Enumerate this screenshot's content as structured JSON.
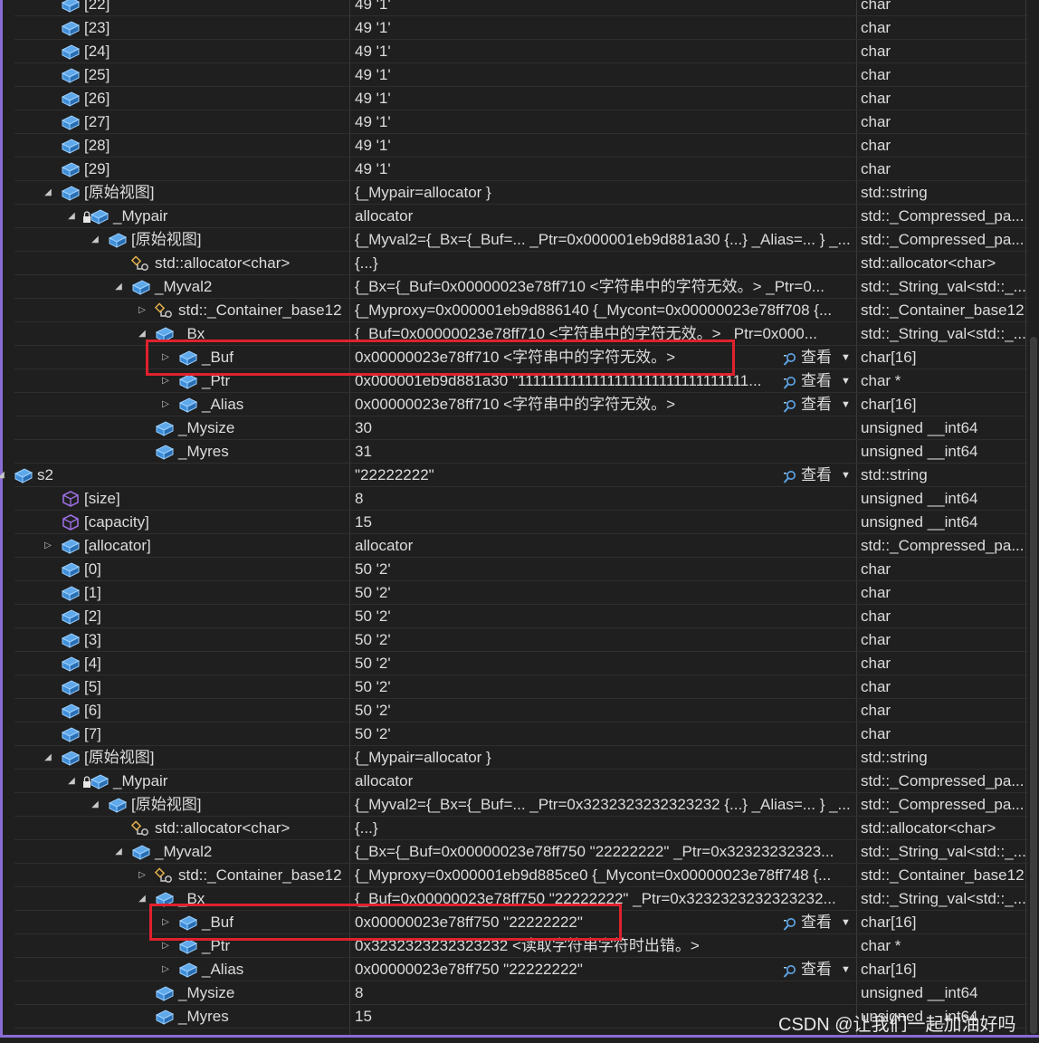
{
  "view_label": "查看",
  "watermark": "CSDN @让我们一起加油好吗",
  "colors": {
    "accent": "#8a6bd6",
    "highlight": "#e0212e",
    "icon_fill": "#3f8ed9",
    "prop_icon": "#9b6ee0"
  },
  "rows": [
    {
      "indent": 3,
      "exp": "none",
      "icon": "variable-icon",
      "name": "[22]",
      "value": "49 '1'",
      "type": "char"
    },
    {
      "indent": 3,
      "exp": "none",
      "icon": "variable-icon",
      "name": "[23]",
      "value": "49 '1'",
      "type": "char"
    },
    {
      "indent": 3,
      "exp": "none",
      "icon": "variable-icon",
      "name": "[24]",
      "value": "49 '1'",
      "type": "char"
    },
    {
      "indent": 3,
      "exp": "none",
      "icon": "variable-icon",
      "name": "[25]",
      "value": "49 '1'",
      "type": "char"
    },
    {
      "indent": 3,
      "exp": "none",
      "icon": "variable-icon",
      "name": "[26]",
      "value": "49 '1'",
      "type": "char"
    },
    {
      "indent": 3,
      "exp": "none",
      "icon": "variable-icon",
      "name": "[27]",
      "value": "49 '1'",
      "type": "char"
    },
    {
      "indent": 3,
      "exp": "none",
      "icon": "variable-icon",
      "name": "[28]",
      "value": "49 '1'",
      "type": "char"
    },
    {
      "indent": 3,
      "exp": "none",
      "icon": "variable-icon",
      "name": "[29]",
      "value": "49 '1'",
      "type": "char"
    },
    {
      "indent": 3,
      "exp": "expanded",
      "icon": "variable-icon",
      "name": "[原始视图]",
      "value": "{_Mypair=allocator }",
      "type": "std::string"
    },
    {
      "indent": 4,
      "exp": "expanded",
      "icon": "variable-icon",
      "lock": true,
      "name": "_Mypair",
      "value": "allocator",
      "type": "std::_Compressed_pa..."
    },
    {
      "indent": 5,
      "exp": "expanded",
      "icon": "variable-icon",
      "name": "[原始视图]",
      "value": "{_Myval2={_Bx={_Buf=... _Ptr=0x000001eb9d881a30 {...} _Alias=... } _...",
      "type": "std::_Compressed_pa..."
    },
    {
      "indent": 6,
      "exp": "none",
      "icon": "base-class-icon",
      "name": "std::allocator<char>",
      "value": "{...}",
      "type": "std::allocator<char>"
    },
    {
      "indent": 6,
      "exp": "expanded",
      "icon": "variable-icon",
      "name": "_Myval2",
      "value": "{_Bx={_Buf=0x00000023e78ff710 <字符串中的字符无效。> _Ptr=0...",
      "type": "std::_String_val<std::_..."
    },
    {
      "indent": 7,
      "exp": "collapsed",
      "icon": "base-class-icon",
      "name": "std::_Container_base12",
      "value": "{_Myproxy=0x000001eb9d886140 {_Mycont=0x00000023e78ff708 {...",
      "type": "std::_Container_base12"
    },
    {
      "indent": 7,
      "exp": "expanded",
      "icon": "variable-icon",
      "name": "_Bx",
      "value": "{_Buf=0x00000023e78ff710 <字符串中的字符无效。> _Ptr=0x000...",
      "type": "std::_String_val<std::_..."
    },
    {
      "indent": 8,
      "exp": "collapsed",
      "icon": "variable-icon",
      "name": "_Buf",
      "value": "0x00000023e78ff710 <字符串中的字符无效。>",
      "type": "char[16]",
      "view": true
    },
    {
      "indent": 8,
      "exp": "collapsed",
      "icon": "variable-icon",
      "name": "_Ptr",
      "value": "0x000001eb9d881a30 \"1111111111111111111111111111111...",
      "type": "char *",
      "view": true
    },
    {
      "indent": 8,
      "exp": "collapsed",
      "icon": "variable-icon",
      "name": "_Alias",
      "value": "0x00000023e78ff710 <字符串中的字符无效。>",
      "type": "char[16]",
      "view": true
    },
    {
      "indent": 7,
      "exp": "none",
      "icon": "variable-icon",
      "name": "_Mysize",
      "value": "30",
      "type": "unsigned __int64"
    },
    {
      "indent": 7,
      "exp": "none",
      "icon": "variable-icon",
      "name": "_Myres",
      "value": "31",
      "type": "unsigned __int64"
    },
    {
      "indent": 1,
      "exp": "expanded",
      "icon": "variable-icon",
      "name": "s2",
      "value": "\"22222222\"",
      "type": "std::string",
      "view": true
    },
    {
      "indent": 3,
      "exp": "none",
      "icon": "property-icon",
      "name": "[size]",
      "value": "8",
      "type": "unsigned __int64"
    },
    {
      "indent": 3,
      "exp": "none",
      "icon": "property-icon",
      "name": "[capacity]",
      "value": "15",
      "type": "unsigned __int64"
    },
    {
      "indent": 3,
      "exp": "collapsed",
      "icon": "variable-icon",
      "name": "[allocator]",
      "value": "allocator",
      "type": "std::_Compressed_pa..."
    },
    {
      "indent": 3,
      "exp": "none",
      "icon": "variable-icon",
      "name": "[0]",
      "value": "50 '2'",
      "type": "char"
    },
    {
      "indent": 3,
      "exp": "none",
      "icon": "variable-icon",
      "name": "[1]",
      "value": "50 '2'",
      "type": "char"
    },
    {
      "indent": 3,
      "exp": "none",
      "icon": "variable-icon",
      "name": "[2]",
      "value": "50 '2'",
      "type": "char"
    },
    {
      "indent": 3,
      "exp": "none",
      "icon": "variable-icon",
      "name": "[3]",
      "value": "50 '2'",
      "type": "char"
    },
    {
      "indent": 3,
      "exp": "none",
      "icon": "variable-icon",
      "name": "[4]",
      "value": "50 '2'",
      "type": "char"
    },
    {
      "indent": 3,
      "exp": "none",
      "icon": "variable-icon",
      "name": "[5]",
      "value": "50 '2'",
      "type": "char"
    },
    {
      "indent": 3,
      "exp": "none",
      "icon": "variable-icon",
      "name": "[6]",
      "value": "50 '2'",
      "type": "char"
    },
    {
      "indent": 3,
      "exp": "none",
      "icon": "variable-icon",
      "name": "[7]",
      "value": "50 '2'",
      "type": "char"
    },
    {
      "indent": 3,
      "exp": "expanded",
      "icon": "variable-icon",
      "name": "[原始视图]",
      "value": "{_Mypair=allocator }",
      "type": "std::string"
    },
    {
      "indent": 4,
      "exp": "expanded",
      "icon": "variable-icon",
      "lock": true,
      "name": "_Mypair",
      "value": "allocator",
      "type": "std::_Compressed_pa..."
    },
    {
      "indent": 5,
      "exp": "expanded",
      "icon": "variable-icon",
      "name": "[原始视图]",
      "value": "{_Myval2={_Bx={_Buf=... _Ptr=0x3232323232323232 {...} _Alias=... } _...",
      "type": "std::_Compressed_pa..."
    },
    {
      "indent": 6,
      "exp": "none",
      "icon": "base-class-icon",
      "name": "std::allocator<char>",
      "value": "{...}",
      "type": "std::allocator<char>"
    },
    {
      "indent": 6,
      "exp": "expanded",
      "icon": "variable-icon",
      "name": "_Myval2",
      "value": "{_Bx={_Buf=0x00000023e78ff750 \"22222222\" _Ptr=0x32323232323...",
      "type": "std::_String_val<std::_..."
    },
    {
      "indent": 7,
      "exp": "collapsed",
      "icon": "base-class-icon",
      "name": "std::_Container_base12",
      "value": "{_Myproxy=0x000001eb9d885ce0 {_Mycont=0x00000023e78ff748 {...",
      "type": "std::_Container_base12"
    },
    {
      "indent": 7,
      "exp": "expanded",
      "icon": "variable-icon",
      "name": "_Bx",
      "value": "{_Buf=0x00000023e78ff750 \"22222222\" _Ptr=0x3232323232323232...",
      "type": "std::_String_val<std::_..."
    },
    {
      "indent": 8,
      "exp": "collapsed",
      "icon": "variable-icon",
      "name": "_Buf",
      "value": "0x00000023e78ff750 \"22222222\"",
      "type": "char[16]",
      "view": true
    },
    {
      "indent": 8,
      "exp": "collapsed",
      "icon": "variable-icon",
      "name": "_Ptr",
      "value": "0x3232323232323232 <读取字符串字符时出错。>",
      "type": "char *"
    },
    {
      "indent": 8,
      "exp": "collapsed",
      "icon": "variable-icon",
      "name": "_Alias",
      "value": "0x00000023e78ff750 \"22222222\"",
      "type": "char[16]",
      "view": true
    },
    {
      "indent": 7,
      "exp": "none",
      "icon": "variable-icon",
      "name": "_Mysize",
      "value": "8",
      "type": "unsigned __int64"
    },
    {
      "indent": 7,
      "exp": "none",
      "icon": "variable-icon",
      "name": "_Myres",
      "value": "15",
      "type": "unsigned __int64"
    }
  ]
}
